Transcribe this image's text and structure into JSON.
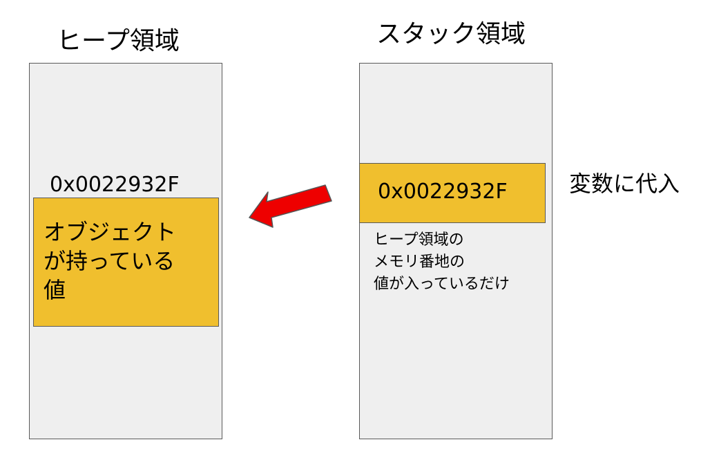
{
  "heap": {
    "title": "ヒープ領域",
    "address": "0x0022932F",
    "object_value_lines": [
      "オブジェクト",
      "が持っている",
      "値"
    ]
  },
  "stack": {
    "title": "スタック領域",
    "address": "0x0022932F",
    "note_lines": [
      "ヒープ領域の",
      "メモリ番地の",
      "値が入っているだけ"
    ]
  },
  "assign_label": "変数に代入",
  "colors": {
    "panel_fill": "#efefef",
    "panel_border": "#595959",
    "block_fill": "#f0bf2e",
    "arrow_fill": "#ee0000",
    "arrow_stroke": "#555555"
  }
}
